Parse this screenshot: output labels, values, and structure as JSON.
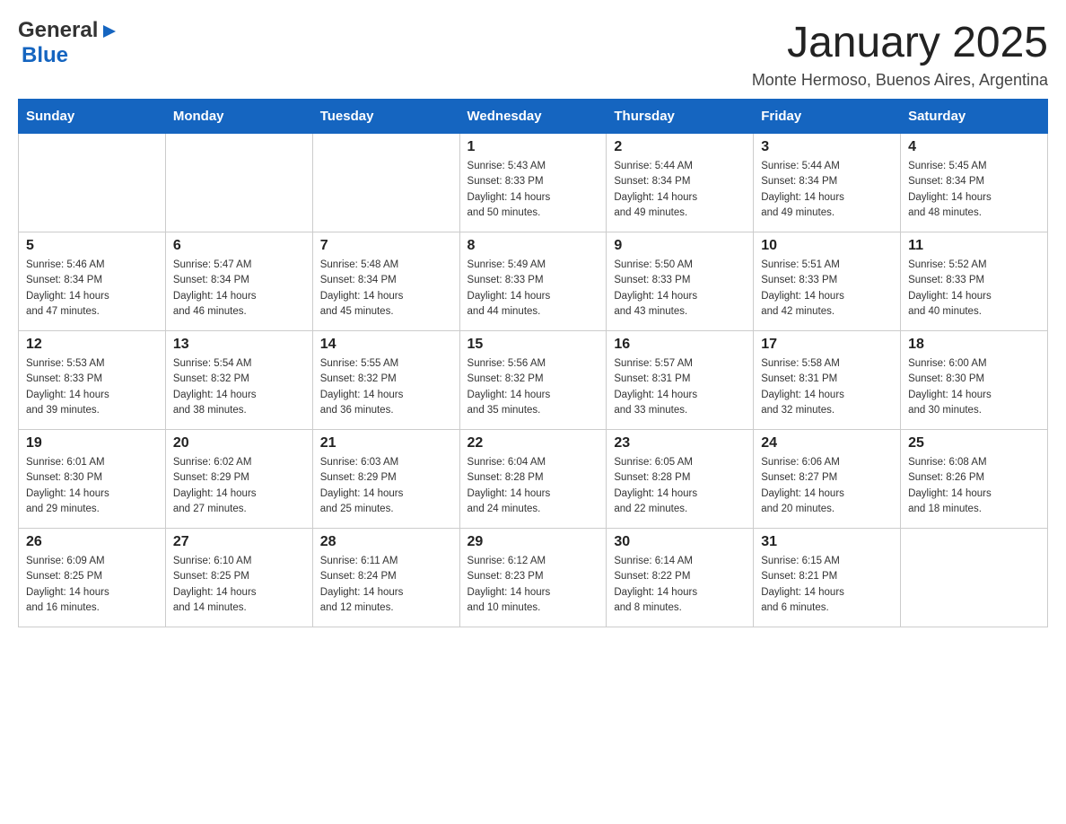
{
  "header": {
    "logo_general": "General",
    "logo_blue": "Blue",
    "month_title": "January 2025",
    "location": "Monte Hermoso, Buenos Aires, Argentina"
  },
  "days_of_week": [
    "Sunday",
    "Monday",
    "Tuesday",
    "Wednesday",
    "Thursday",
    "Friday",
    "Saturday"
  ],
  "weeks": [
    [
      {
        "day": "",
        "info": ""
      },
      {
        "day": "",
        "info": ""
      },
      {
        "day": "",
        "info": ""
      },
      {
        "day": "1",
        "info": "Sunrise: 5:43 AM\nSunset: 8:33 PM\nDaylight: 14 hours\nand 50 minutes."
      },
      {
        "day": "2",
        "info": "Sunrise: 5:44 AM\nSunset: 8:34 PM\nDaylight: 14 hours\nand 49 minutes."
      },
      {
        "day": "3",
        "info": "Sunrise: 5:44 AM\nSunset: 8:34 PM\nDaylight: 14 hours\nand 49 minutes."
      },
      {
        "day": "4",
        "info": "Sunrise: 5:45 AM\nSunset: 8:34 PM\nDaylight: 14 hours\nand 48 minutes."
      }
    ],
    [
      {
        "day": "5",
        "info": "Sunrise: 5:46 AM\nSunset: 8:34 PM\nDaylight: 14 hours\nand 47 minutes."
      },
      {
        "day": "6",
        "info": "Sunrise: 5:47 AM\nSunset: 8:34 PM\nDaylight: 14 hours\nand 46 minutes."
      },
      {
        "day": "7",
        "info": "Sunrise: 5:48 AM\nSunset: 8:34 PM\nDaylight: 14 hours\nand 45 minutes."
      },
      {
        "day": "8",
        "info": "Sunrise: 5:49 AM\nSunset: 8:33 PM\nDaylight: 14 hours\nand 44 minutes."
      },
      {
        "day": "9",
        "info": "Sunrise: 5:50 AM\nSunset: 8:33 PM\nDaylight: 14 hours\nand 43 minutes."
      },
      {
        "day": "10",
        "info": "Sunrise: 5:51 AM\nSunset: 8:33 PM\nDaylight: 14 hours\nand 42 minutes."
      },
      {
        "day": "11",
        "info": "Sunrise: 5:52 AM\nSunset: 8:33 PM\nDaylight: 14 hours\nand 40 minutes."
      }
    ],
    [
      {
        "day": "12",
        "info": "Sunrise: 5:53 AM\nSunset: 8:33 PM\nDaylight: 14 hours\nand 39 minutes."
      },
      {
        "day": "13",
        "info": "Sunrise: 5:54 AM\nSunset: 8:32 PM\nDaylight: 14 hours\nand 38 minutes."
      },
      {
        "day": "14",
        "info": "Sunrise: 5:55 AM\nSunset: 8:32 PM\nDaylight: 14 hours\nand 36 minutes."
      },
      {
        "day": "15",
        "info": "Sunrise: 5:56 AM\nSunset: 8:32 PM\nDaylight: 14 hours\nand 35 minutes."
      },
      {
        "day": "16",
        "info": "Sunrise: 5:57 AM\nSunset: 8:31 PM\nDaylight: 14 hours\nand 33 minutes."
      },
      {
        "day": "17",
        "info": "Sunrise: 5:58 AM\nSunset: 8:31 PM\nDaylight: 14 hours\nand 32 minutes."
      },
      {
        "day": "18",
        "info": "Sunrise: 6:00 AM\nSunset: 8:30 PM\nDaylight: 14 hours\nand 30 minutes."
      }
    ],
    [
      {
        "day": "19",
        "info": "Sunrise: 6:01 AM\nSunset: 8:30 PM\nDaylight: 14 hours\nand 29 minutes."
      },
      {
        "day": "20",
        "info": "Sunrise: 6:02 AM\nSunset: 8:29 PM\nDaylight: 14 hours\nand 27 minutes."
      },
      {
        "day": "21",
        "info": "Sunrise: 6:03 AM\nSunset: 8:29 PM\nDaylight: 14 hours\nand 25 minutes."
      },
      {
        "day": "22",
        "info": "Sunrise: 6:04 AM\nSunset: 8:28 PM\nDaylight: 14 hours\nand 24 minutes."
      },
      {
        "day": "23",
        "info": "Sunrise: 6:05 AM\nSunset: 8:28 PM\nDaylight: 14 hours\nand 22 minutes."
      },
      {
        "day": "24",
        "info": "Sunrise: 6:06 AM\nSunset: 8:27 PM\nDaylight: 14 hours\nand 20 minutes."
      },
      {
        "day": "25",
        "info": "Sunrise: 6:08 AM\nSunset: 8:26 PM\nDaylight: 14 hours\nand 18 minutes."
      }
    ],
    [
      {
        "day": "26",
        "info": "Sunrise: 6:09 AM\nSunset: 8:25 PM\nDaylight: 14 hours\nand 16 minutes."
      },
      {
        "day": "27",
        "info": "Sunrise: 6:10 AM\nSunset: 8:25 PM\nDaylight: 14 hours\nand 14 minutes."
      },
      {
        "day": "28",
        "info": "Sunrise: 6:11 AM\nSunset: 8:24 PM\nDaylight: 14 hours\nand 12 minutes."
      },
      {
        "day": "29",
        "info": "Sunrise: 6:12 AM\nSunset: 8:23 PM\nDaylight: 14 hours\nand 10 minutes."
      },
      {
        "day": "30",
        "info": "Sunrise: 6:14 AM\nSunset: 8:22 PM\nDaylight: 14 hours\nand 8 minutes."
      },
      {
        "day": "31",
        "info": "Sunrise: 6:15 AM\nSunset: 8:21 PM\nDaylight: 14 hours\nand 6 minutes."
      },
      {
        "day": "",
        "info": ""
      }
    ]
  ]
}
